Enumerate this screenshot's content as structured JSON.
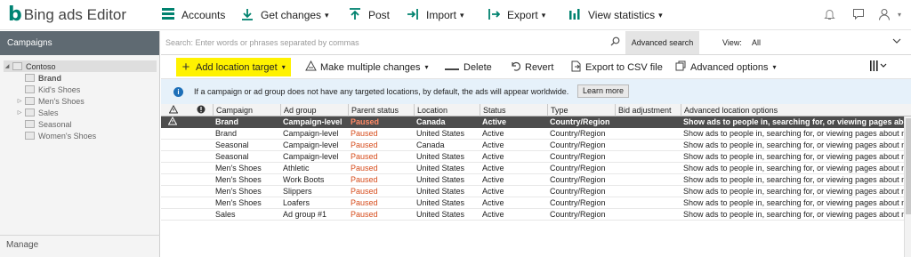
{
  "app": {
    "logo_glyph": "b",
    "logo_text": "Bing ads Editor"
  },
  "toolbar": {
    "accounts": "Accounts",
    "get_changes": "Get changes",
    "post": "Post",
    "import": "Import",
    "export": "Export",
    "view_statistics": "View statistics"
  },
  "sidebar": {
    "title": "Campaigns",
    "manage": "Manage",
    "tree": [
      {
        "label": "Contoso",
        "level": 0,
        "expander": "◢",
        "selected": true
      },
      {
        "label": "Brand",
        "level": 1,
        "expander": "",
        "bold": true
      },
      {
        "label": "Kid's Shoes",
        "level": 1,
        "expander": ""
      },
      {
        "label": "Men's Shoes",
        "level": 1,
        "expander": "▷"
      },
      {
        "label": "Sales",
        "level": 1,
        "expander": "▷"
      },
      {
        "label": "Seasonal",
        "level": 1,
        "expander": ""
      },
      {
        "label": "Women's Shoes",
        "level": 1,
        "expander": ""
      }
    ]
  },
  "search": {
    "placeholder": "Search: Enter words or phrases separated by commas",
    "advanced_label": "Advanced search",
    "view_label": "View:",
    "view_value": "All"
  },
  "actions": {
    "add_location_target": "Add location target",
    "make_multiple_changes": "Make multiple changes",
    "delete": "Delete",
    "revert": "Revert",
    "export_csv": "Export to CSV file",
    "advanced_options": "Advanced options"
  },
  "banner": {
    "text": "If a campaign or ad group does not have any targeted locations, by default, the ads will appear worldwide.",
    "learn_more": "Learn more"
  },
  "grid": {
    "columns": [
      "Campaign",
      "Ad group",
      "Parent status",
      "Location",
      "Status",
      "Type",
      "Bid adjustment",
      "Advanced location options"
    ],
    "rows": [
      [
        "Brand",
        "Campaign-level",
        "Paused",
        "Canada",
        "Active",
        "Country/Region",
        "",
        "Show ads to people in, searching for, or viewing pages about m"
      ],
      [
        "Brand",
        "Campaign-level",
        "Paused",
        "United States",
        "Active",
        "Country/Region",
        "",
        "Show ads to people in, searching for, or viewing pages about m"
      ],
      [
        "Seasonal",
        "Campaign-level",
        "Paused",
        "Canada",
        "Active",
        "Country/Region",
        "",
        "Show ads to people in, searching for, or viewing pages about m"
      ],
      [
        "Seasonal",
        "Campaign-level",
        "Paused",
        "United States",
        "Active",
        "Country/Region",
        "",
        "Show ads to people in, searching for, or viewing pages about m"
      ],
      [
        "Men's Shoes",
        "Athletic",
        "Paused",
        "United States",
        "Active",
        "Country/Region",
        "",
        "Show ads to people in, searching for, or viewing pages about m"
      ],
      [
        "Men's Shoes",
        "Work Boots",
        "Paused",
        "United States",
        "Active",
        "Country/Region",
        "",
        "Show ads to people in, searching for, or viewing pages about m"
      ],
      [
        "Men's Shoes",
        "Slippers",
        "Paused",
        "United States",
        "Active",
        "Country/Region",
        "",
        "Show ads to people in, searching for, or viewing pages about m"
      ],
      [
        "Men's Shoes",
        "Loafers",
        "Paused",
        "United States",
        "Active",
        "Country/Region",
        "",
        "Show ads to people in, searching for, or viewing pages about m"
      ],
      [
        "Sales",
        "Ad group #1",
        "Paused",
        "United States",
        "Active",
        "Country/Region",
        "",
        "Show ads to people in, searching for, or viewing pages about m"
      ]
    ],
    "selected_row": 0
  },
  "colors": {
    "brand": "#008373",
    "accent_teal": "#00826f",
    "highlight": "#fff200",
    "paused": "#d64b1a",
    "sidebar_header": "#5f6a72",
    "selected_row": "#4d4d4d"
  }
}
